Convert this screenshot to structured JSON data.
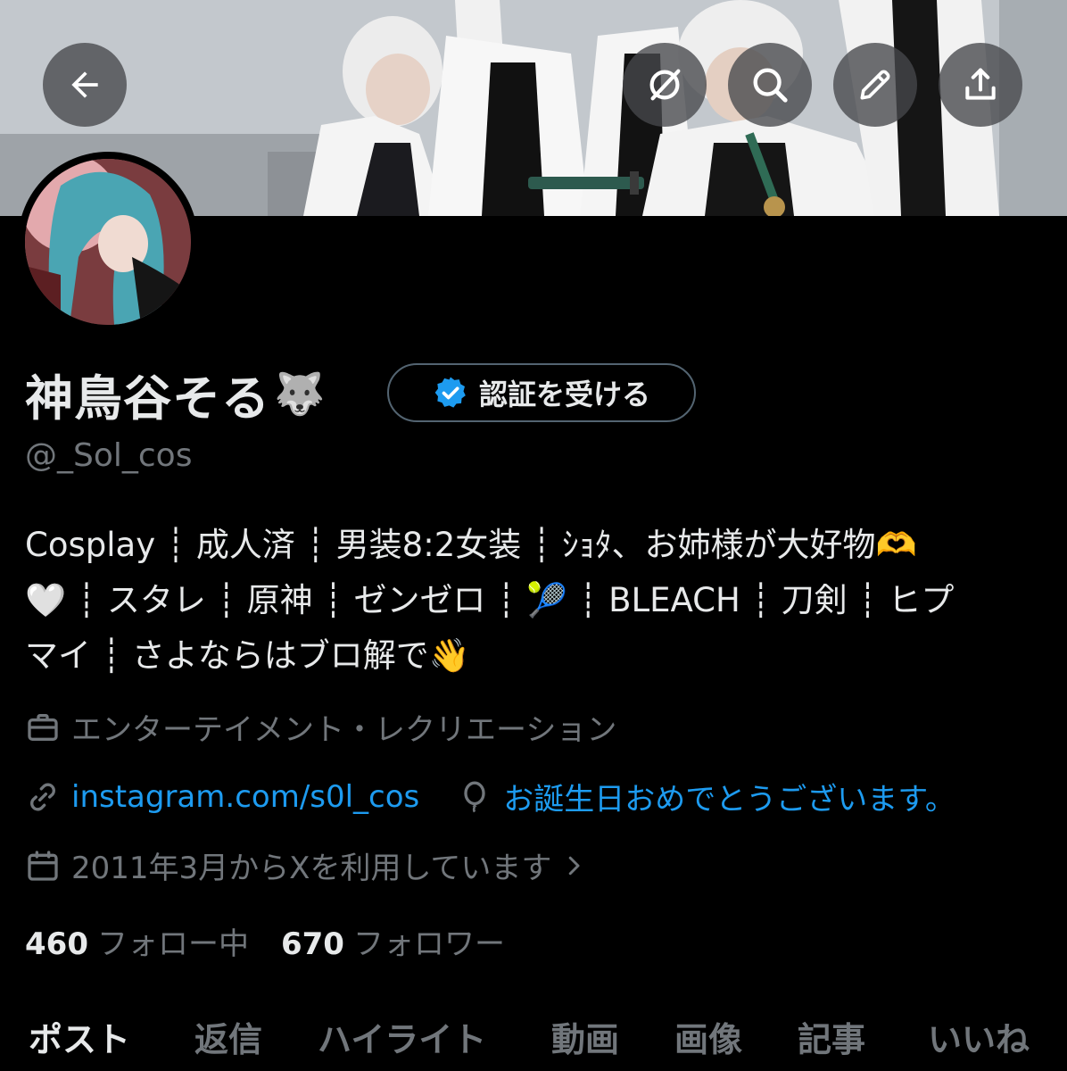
{
  "header": {
    "back_icon": "arrow-left-icon",
    "actions": [
      {
        "icon": "grok-icon"
      },
      {
        "icon": "search-icon"
      },
      {
        "icon": "pencil-icon"
      },
      {
        "icon": "share-icon"
      }
    ]
  },
  "profile": {
    "display_name": "神鳥谷そる",
    "name_emoji": "🐺",
    "verify_button_label": "認証を受ける",
    "handle": "@_Sol_cos",
    "bio_lines": [
      "Cosplay ┊ 成人済 ┊ 男装8:2女装 ┊ ｼｮﾀ、お姉様が大好物🫶",
      "🤍 ┊ スタレ ┊ 原神 ┊ ゼンゼロ ┊ 🎾 ┊ BLEACH ┊ 刀剣 ┊ ヒプ",
      "マイ ┊ さよならはブロ解で👋"
    ],
    "category": "エンターテイメント・レクリエーション",
    "link": "instagram.com/s0l_cos",
    "birthday": "お誕生日おめでとうございます。",
    "joined": "2011年3月からXを利用しています",
    "following_count": "460",
    "following_label": "フォロー中",
    "followers_count": "670",
    "followers_label": "フォロワー"
  },
  "tabs": [
    "ポスト",
    "返信",
    "ハイライト",
    "動画",
    "画像",
    "記事",
    "いいね"
  ],
  "colors": {
    "accent": "#1d9bf0",
    "muted": "#71767b",
    "text": "#e7e9ea",
    "background": "#000000"
  }
}
